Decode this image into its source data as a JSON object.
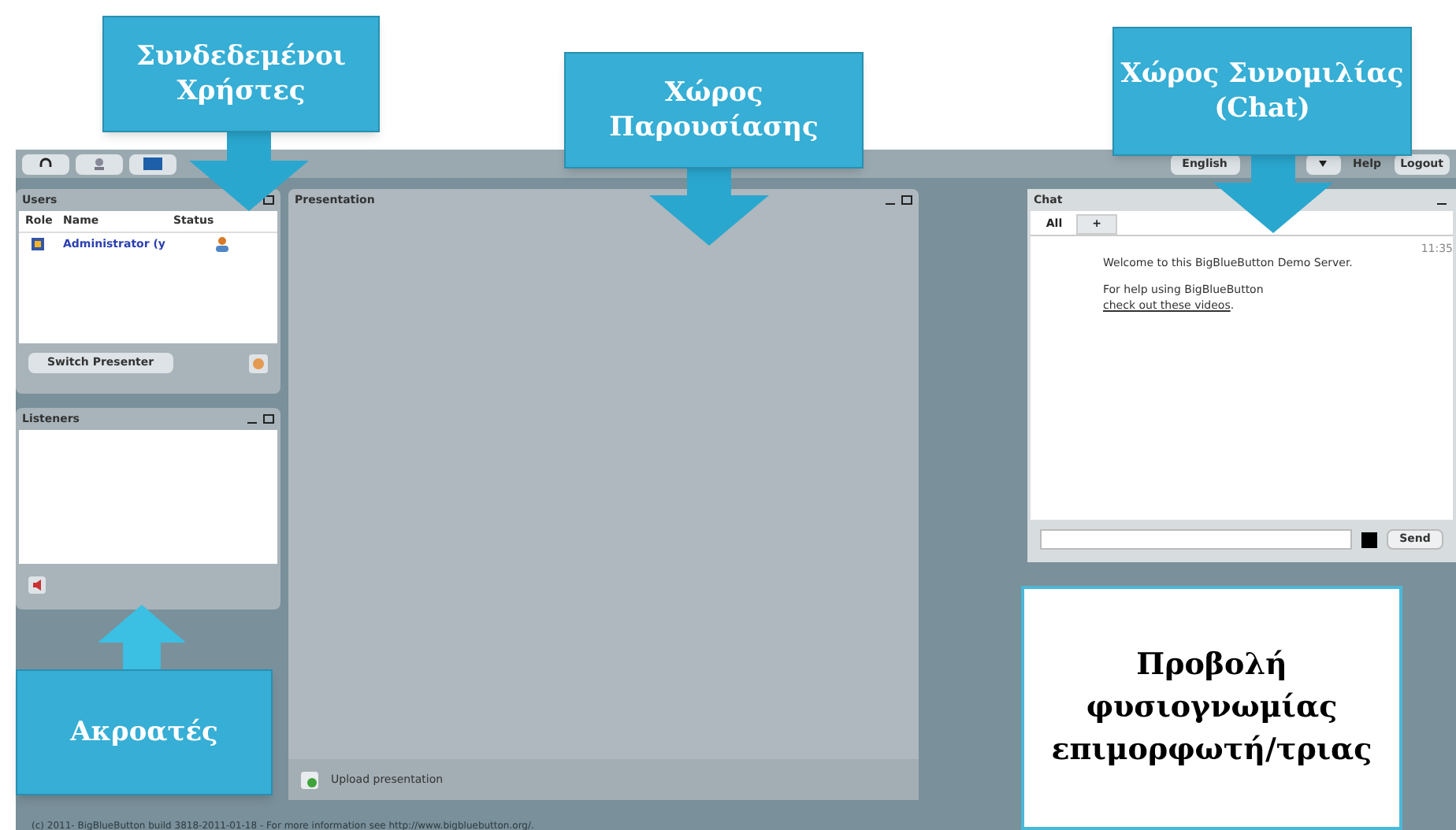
{
  "toolbar": {
    "right_buttons": [
      "English",
      "Help",
      "Logout"
    ]
  },
  "users": {
    "title": "Users",
    "columns": [
      "Role",
      "Name",
      "Status"
    ],
    "rows": [
      {
        "name": "Administrator (y"
      }
    ],
    "button": "Switch Presenter"
  },
  "listeners": {
    "title": "Listeners"
  },
  "presentation": {
    "title": "Presentation",
    "upload": "Upload presentation"
  },
  "chat": {
    "title": "Chat",
    "tabs": [
      {
        "label": "All",
        "selected": true
      },
      {
        "label": "+",
        "selected": false
      }
    ],
    "time": "11:35",
    "welcome": "Welcome to this BigBlueButton Demo Server.",
    "help": "For help using BigBlueButton ",
    "link": "check out these videos",
    "link_end": ".",
    "send": "Send"
  },
  "footer": "(c) 2011- BigBlueButton build 3818-2011-01-18 - For more information see http://www.bigbluebutton.org/.",
  "callouts": [
    {
      "text": "Συνδεδεμένοι Χρήστες",
      "kind": "down"
    },
    {
      "text": "Χώρος Παρουσίασης",
      "kind": "down"
    },
    {
      "text": "Χώρος Συνομιλίας (Chat)",
      "kind": "down"
    },
    {
      "text": "Ακροατές",
      "kind": "up"
    }
  ],
  "video_note": "Προβολή φυσιογνωμίας επιμορφωτή/τριας"
}
